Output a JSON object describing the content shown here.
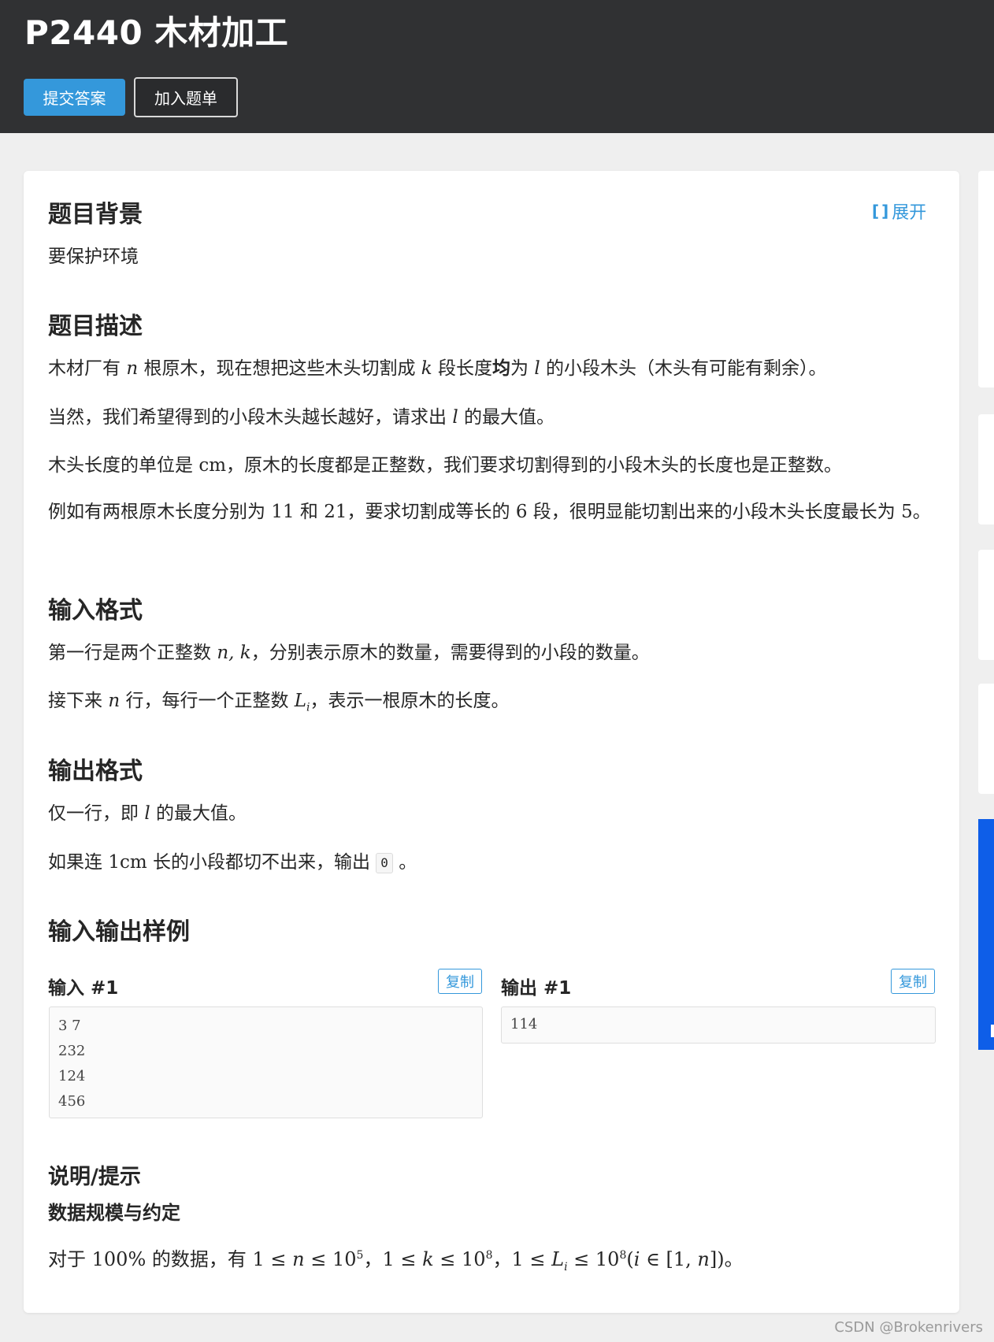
{
  "header": {
    "title": "P2440 木材加工",
    "submit_label": "提交答案",
    "add_label": "加入题单"
  },
  "expand_label": "展开",
  "sections": {
    "background": {
      "heading": "题目背景",
      "text": "要保护环境"
    },
    "description": {
      "heading": "题目描述",
      "p1": {
        "a": "木材厂有 ",
        "n": "n",
        "b": " 根原木，现在想把这些木头切割成 ",
        "k": "k",
        "c": " 段长度",
        "bold": "均",
        "d": "为 ",
        "l": "l",
        "e": " 的小段木头（木头有可能有剩余）。"
      },
      "p2": {
        "a": "当然，我们希望得到的小段木头越长越好，请求出 ",
        "l": "l",
        "b": " 的最大值。"
      },
      "p3": {
        "a": "木头长度的单位是 ",
        "cm": "cm",
        "b": "，原木的长度都是正整数，我们要求切割得到的小段木头的长度也是正整数。"
      },
      "p4": {
        "a": "例如有两根原木长度分别为 ",
        "v1": "11",
        "b": " 和 ",
        "v2": "21",
        "c": "，要求切割成等长的 ",
        "v3": "6",
        "d": " 段，很明显能切割出来的小段木头长度最长为 ",
        "v4": "5",
        "e": "。"
      }
    },
    "input_format": {
      "heading": "输入格式",
      "p1": {
        "a": "第一行是两个正整数 ",
        "nk": "n, k",
        "b": "，分别表示原木的数量，需要得到的小段的数量。"
      },
      "p2": {
        "a": "接下来 ",
        "n": "n",
        "b": " 行，每行一个正整数 ",
        "L": "L",
        "i": "i",
        "c": "，表示一根原木的长度。"
      }
    },
    "output_format": {
      "heading": "输出格式",
      "p1": {
        "a": "仅一行，即 ",
        "l": "l",
        "b": " 的最大值。"
      },
      "p2": {
        "a": "如果连 ",
        "v": "1cm",
        "b": " 长的小段都切不出来，输出 ",
        "code": "0",
        "c": " 。"
      }
    },
    "samples": {
      "heading": "输入输出样例",
      "input_label": "输入 #1",
      "output_label": "输出 #1",
      "copy_label": "复制",
      "input_lines": [
        "3 7",
        "232",
        "124",
        "456"
      ],
      "output_lines": [
        "114"
      ]
    },
    "hint": {
      "heading": "说明/提示",
      "subheading": "数据规模与约定",
      "a": "对于 ",
      "pct": "100%",
      "b": " 的数据，有 ",
      "c1": "1 ≤ ",
      "n": "n",
      "c2": " ≤ 10",
      "e1": "5",
      "sep1": "，",
      "c3": "1 ≤ ",
      "k": "k",
      "c4": " ≤ 10",
      "e2": "8",
      "sep2": "，",
      "c5": "1 ≤ ",
      "L": "L",
      "i": "i",
      "c6": " ≤ 10",
      "e3": "8",
      "c7": "(",
      "i2": "i",
      "c8": " ∈ [1, ",
      "n2": "n",
      "c9": "])",
      "end": "。"
    }
  },
  "watermark": "CSDN @Brokenrivers",
  "colors": {
    "header_bg": "#303133",
    "primary": "#3498db",
    "sidebar_blue": "#0e5ee8"
  }
}
